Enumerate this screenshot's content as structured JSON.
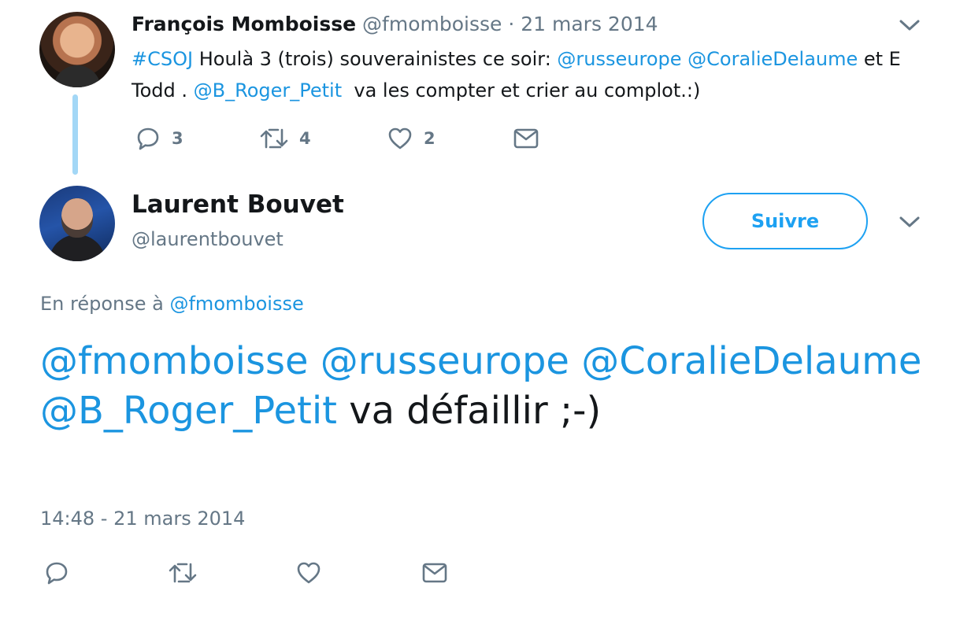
{
  "parent_tweet": {
    "name": "François Momboisse",
    "handle": "@fmomboisse",
    "separator": " · ",
    "date": "21 mars 2014",
    "text_parts": [
      {
        "t": "#CSOJ",
        "link": true
      },
      {
        "t": " Houlà 3 (trois) souverainistes ce soir: ",
        "link": false
      },
      {
        "t": "@russeurope",
        "link": true
      },
      {
        "t": " ",
        "link": false
      },
      {
        "t": "@CoralieDelaume",
        "link": true
      },
      {
        "t": " et E Todd . ",
        "link": false
      },
      {
        "t": "@B_Roger_Petit",
        "link": true
      },
      {
        "t": "  va les compter et crier au complot.:)",
        "link": false
      }
    ],
    "actions": {
      "reply_count": "3",
      "retweet_count": "4",
      "like_count": "2"
    }
  },
  "main_tweet": {
    "name": "Laurent Bouvet",
    "handle": "@laurentbouvet",
    "follow_label": "Suivre",
    "reply_prefix": "En réponse à ",
    "reply_handle": "@fmomboisse",
    "text_parts": [
      {
        "t": "@fmomboisse",
        "link": true
      },
      {
        "t": " ",
        "link": false
      },
      {
        "t": "@russeurope",
        "link": true
      },
      {
        "t": " ",
        "link": false
      },
      {
        "t": "@CoralieDelaume",
        "link": true
      },
      {
        "t": " ",
        "link": false
      },
      {
        "t": "@B_Roger_Petit",
        "link": true
      },
      {
        "t": " va défaillir ;-)",
        "link": false
      }
    ],
    "timestamp": "14:48 - 21 mars 2014"
  },
  "colors": {
    "link": "#1b95e0",
    "muted": "#657786",
    "text": "#14171a",
    "thread_line": "#a3d7f6",
    "follow_border": "#1da1f2"
  },
  "icons": [
    "reply-icon",
    "retweet-icon",
    "like-icon",
    "direct-message-icon",
    "chevron-down-icon"
  ]
}
